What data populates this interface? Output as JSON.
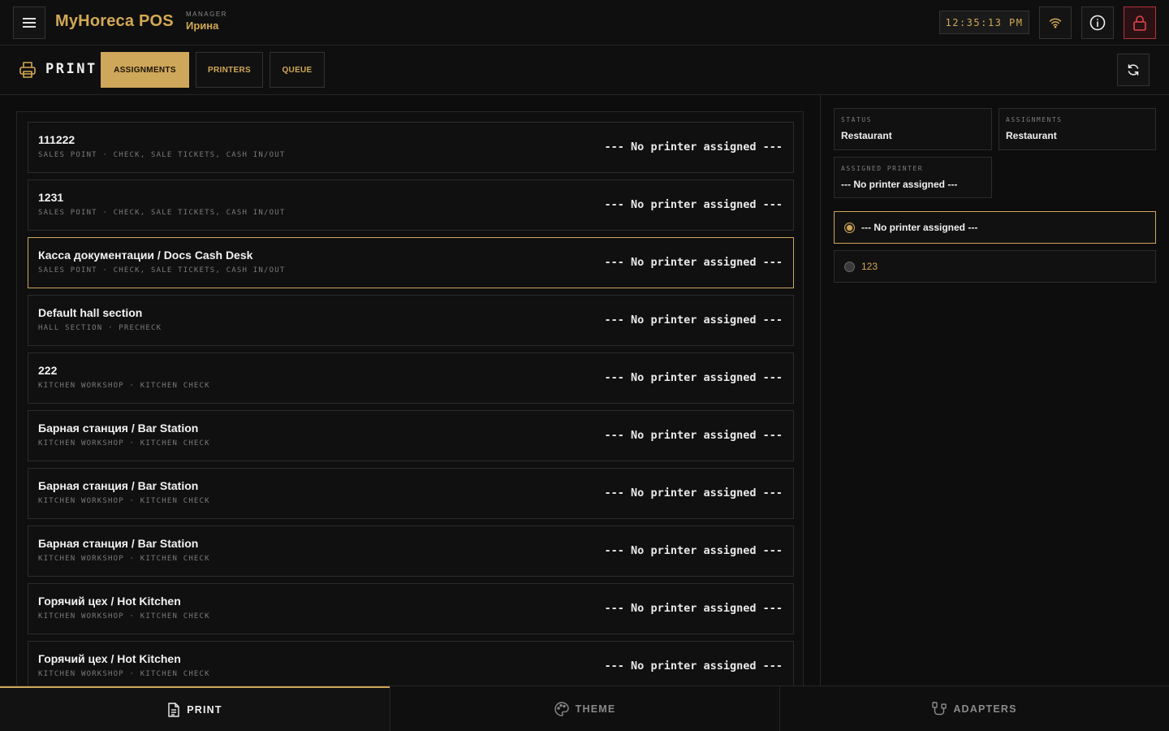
{
  "header": {
    "brand": "MyHoreca POS",
    "user_role": "MANAGER",
    "user_name": "Ирина",
    "clock": "12:35:13 PM"
  },
  "subheader": {
    "title": "PRINT",
    "tabs": [
      {
        "label": "ASSIGNMENTS",
        "active": true
      },
      {
        "label": "PRINTERS",
        "active": false
      },
      {
        "label": "QUEUE",
        "active": false
      }
    ]
  },
  "assignments": [
    {
      "title": "111222",
      "meta": "SALES POINT · CHECK, SALE TICKETS, CASH IN/OUT",
      "printer": "--- No printer assigned ---",
      "selected": false
    },
    {
      "title": "1231",
      "meta": "SALES POINT · CHECK, SALE TICKETS, CASH IN/OUT",
      "printer": "--- No printer assigned ---",
      "selected": false
    },
    {
      "title": "Касса документации / Docs Cash Desk",
      "meta": "SALES POINT · CHECK, SALE TICKETS, CASH IN/OUT",
      "printer": "--- No printer assigned ---",
      "selected": true
    },
    {
      "title": "Default hall section",
      "meta": "HALL SECTION · PRECHECK",
      "printer": "--- No printer assigned ---",
      "selected": false
    },
    {
      "title": "222",
      "meta": "KITCHEN WORKSHOP · KITCHEN CHECK",
      "printer": "--- No printer assigned ---",
      "selected": false
    },
    {
      "title": "Барная станция / Bar Station",
      "meta": "KITCHEN WORKSHOP · KITCHEN CHECK",
      "printer": "--- No printer assigned ---",
      "selected": false
    },
    {
      "title": "Барная станция / Bar Station",
      "meta": "KITCHEN WORKSHOP · KITCHEN CHECK",
      "printer": "--- No printer assigned ---",
      "selected": false
    },
    {
      "title": "Барная станция / Bar Station",
      "meta": "KITCHEN WORKSHOP · KITCHEN CHECK",
      "printer": "--- No printer assigned ---",
      "selected": false
    },
    {
      "title": "Горячий цех / Hot Kitchen",
      "meta": "KITCHEN WORKSHOP · KITCHEN CHECK",
      "printer": "--- No printer assigned ---",
      "selected": false
    },
    {
      "title": "Горячий цех / Hot Kitchen",
      "meta": "KITCHEN WORKSHOP · KITCHEN CHECK",
      "printer": "--- No printer assigned ---",
      "selected": false
    }
  ],
  "details": {
    "status_label": "STATUS",
    "status_value": "Restaurant",
    "assignments_label": "ASSIGNMENTS",
    "assignments_value": "Restaurant",
    "assigned_printer_label": "ASSIGNED PRINTER",
    "assigned_printer_value": "--- No printer assigned ---"
  },
  "printer_options": [
    {
      "label": "--- No printer assigned ---",
      "selected": true
    },
    {
      "label": "123",
      "selected": false
    }
  ],
  "bottom_nav": {
    "print": "PRINT",
    "theme": "THEME",
    "adapters": "ADAPTERS"
  },
  "colors": {
    "accent": "#cfa75a",
    "background": "#0d0d0d",
    "danger": "#b0353d"
  }
}
